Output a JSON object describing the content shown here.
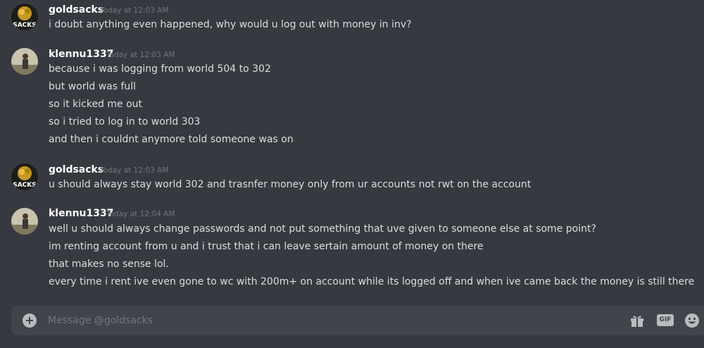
{
  "messages": [
    {
      "author": "goldsacks",
      "timestamp": "Today at 12:03 AM",
      "avatar_text": "SACKS",
      "lines": [
        "i doubt anything even happened, why would u log out with money in inv?"
      ]
    },
    {
      "author": "klennu1337",
      "timestamp": "Today at 12:03 AM",
      "lines": [
        "because i was logging from world 504 to 302",
        "but world was full",
        "so it kicked me out",
        "so i tried to log in to world 303",
        "and then i couldnt anymore told someone was on"
      ]
    },
    {
      "author": "goldsacks",
      "timestamp": "Today at 12:03 AM",
      "avatar_text": "SACKS",
      "lines": [
        "u should always stay world 302 and trasnfer money only from ur accounts not rwt on the account"
      ]
    },
    {
      "author": "klennu1337",
      "timestamp": "Today at 12:04 AM",
      "lines": [
        "well u should always change passwords and not put something that uve given to someone else at some point?",
        "im renting account from u and i trust that i can leave sertain amount of money on there",
        "that makes no sense lol.",
        "every time i rent ive even gone to wc with 200m+ on account while its logged off and when ive came back the money is still there"
      ]
    }
  ],
  "composer": {
    "placeholder": "Message @goldsacks",
    "gif_label": "GIF"
  },
  "colors": {
    "background": "#36393f",
    "composer": "#40444b",
    "username": "#ffffff",
    "text": "#dcddde",
    "muted": "#72767d",
    "icon": "#b9bbbe"
  },
  "icons": [
    "add-icon",
    "gift-icon",
    "gif-icon",
    "emoji-icon"
  ]
}
